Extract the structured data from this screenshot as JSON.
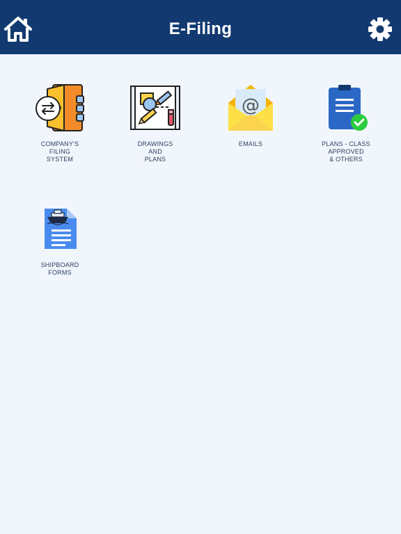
{
  "header": {
    "title": "E-Filing",
    "left_icon": "home-icon",
    "right_icon": "gear-icon",
    "bar_color": "#133a70"
  },
  "tiles": [
    {
      "label": "COMPANY'S\nFILING\nSYSTEM",
      "icon": "company-filing-folder-icon"
    },
    {
      "label": "DRAWINGS\nAND\nPLANS",
      "icon": "drawings-blueprint-icon"
    },
    {
      "label": "EMAILS",
      "icon": "email-envelope-icon"
    },
    {
      "label": "PLANS - CLASS\nAPPROVED\n& OTHERS",
      "icon": "clipboard-check-icon"
    },
    {
      "label": "SHIPBOARD\nFORMS",
      "icon": "shipboard-document-icon"
    }
  ]
}
